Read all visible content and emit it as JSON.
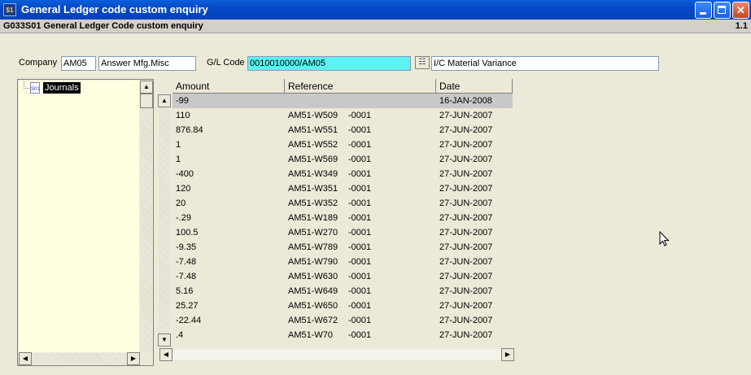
{
  "window": {
    "title": "General Ledger code custom enquiry",
    "app_icon_glyph": "$1",
    "icons": [
      "app-icon",
      "minimize-icon",
      "maximize-icon",
      "close-icon"
    ]
  },
  "header": {
    "title": "G033S01 General Ledger Code custom enquiry",
    "version": "1.1"
  },
  "form": {
    "company_label": "Company",
    "company_code": "AM05",
    "company_name": "Answer Mfg.Misc",
    "gl_label": "G/L Code",
    "gl_code": "0010010000/AM05",
    "gl_description": "I/C Material Variance",
    "lookup_icon": "list-lookup-icon"
  },
  "tree": {
    "root_label": "Journals",
    "root_icon_glyph": "S01"
  },
  "grid": {
    "columns": [
      {
        "label": "Amount"
      },
      {
        "label": "Reference"
      },
      {
        "label": "Date"
      }
    ],
    "rows": [
      {
        "amount": "-99",
        "ref": "",
        "suffix": "",
        "date": "16-JAN-2008"
      },
      {
        "amount": "110",
        "ref": "AM51-W509",
        "suffix": "-0001",
        "date": "27-JUN-2007"
      },
      {
        "amount": "876.84",
        "ref": "AM51-W551",
        "suffix": "-0001",
        "date": "27-JUN-2007"
      },
      {
        "amount": "1",
        "ref": "AM51-W552",
        "suffix": "-0001",
        "date": "27-JUN-2007"
      },
      {
        "amount": "1",
        "ref": "AM51-W569",
        "suffix": "-0001",
        "date": "27-JUN-2007"
      },
      {
        "amount": "-400",
        "ref": "AM51-W349",
        "suffix": "-0001",
        "date": "27-JUN-2007"
      },
      {
        "amount": "120",
        "ref": "AM51-W351",
        "suffix": "-0001",
        "date": "27-JUN-2007"
      },
      {
        "amount": "20",
        "ref": "AM51-W352",
        "suffix": "-0001",
        "date": "27-JUN-2007"
      },
      {
        "amount": "-.29",
        "ref": "AM51-W189",
        "suffix": "-0001",
        "date": "27-JUN-2007"
      },
      {
        "amount": "100.5",
        "ref": "AM51-W270",
        "suffix": "-0001",
        "date": "27-JUN-2007"
      },
      {
        "amount": "-9.35",
        "ref": "AM51-W789",
        "suffix": "-0001",
        "date": "27-JUN-2007"
      },
      {
        "amount": "-7.48",
        "ref": "AM51-W790",
        "suffix": "-0001",
        "date": "27-JUN-2007"
      },
      {
        "amount": "-7.48",
        "ref": "AM51-W630",
        "suffix": "-0001",
        "date": "27-JUN-2007"
      },
      {
        "amount": "5.16",
        "ref": "AM51-W649",
        "suffix": "-0001",
        "date": "27-JUN-2007"
      },
      {
        "amount": "25.27",
        "ref": "AM51-W650",
        "suffix": "-0001",
        "date": "27-JUN-2007"
      },
      {
        "amount": "-22.44",
        "ref": "AM51-W672",
        "suffix": "-0001",
        "date": "27-JUN-2007"
      },
      {
        "amount": ".4",
        "ref": "AM51-W70",
        "suffix": "-0001",
        "date": "27-JUN-2007"
      }
    ]
  },
  "colors": {
    "title_bar": "#0548c8",
    "gl_field_highlight": "#5ef1f1",
    "tree_background": "#ffffe1",
    "selected_row": "#c8c8c8"
  }
}
